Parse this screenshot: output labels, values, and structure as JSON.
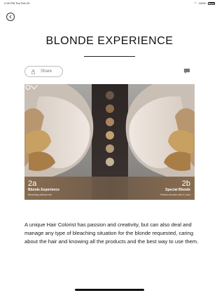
{
  "status_bar": {
    "time": "2:26 PM",
    "date": "Thu Feb 20",
    "battery": "100%"
  },
  "page": {
    "title": "BLONDE EXPERIENCE",
    "share_label": "Share"
  },
  "hero": {
    "left_number": "2a",
    "left_label": "Blonde Experience",
    "left_sub": "Bleaching without risk",
    "right_number": "2b",
    "right_label": "Special Blonde",
    "right_sub": "Perfect blondes with 4 color",
    "swatch_colors": [
      "#6b5645",
      "#8c6a4d",
      "#a98560",
      "#c2a06f",
      "#b39777",
      "#c4b39a"
    ]
  },
  "body": {
    "paragraph": "A unique Hair Colorist has passion and creativity, but can also deal and manage any type of bleaching situation for the blonde requested, caring about the hair and knowing  all the products and the best way to use them."
  },
  "icons": {
    "back": "chevron-left-icon",
    "share": "share-icon",
    "comment": "comment-icon"
  }
}
